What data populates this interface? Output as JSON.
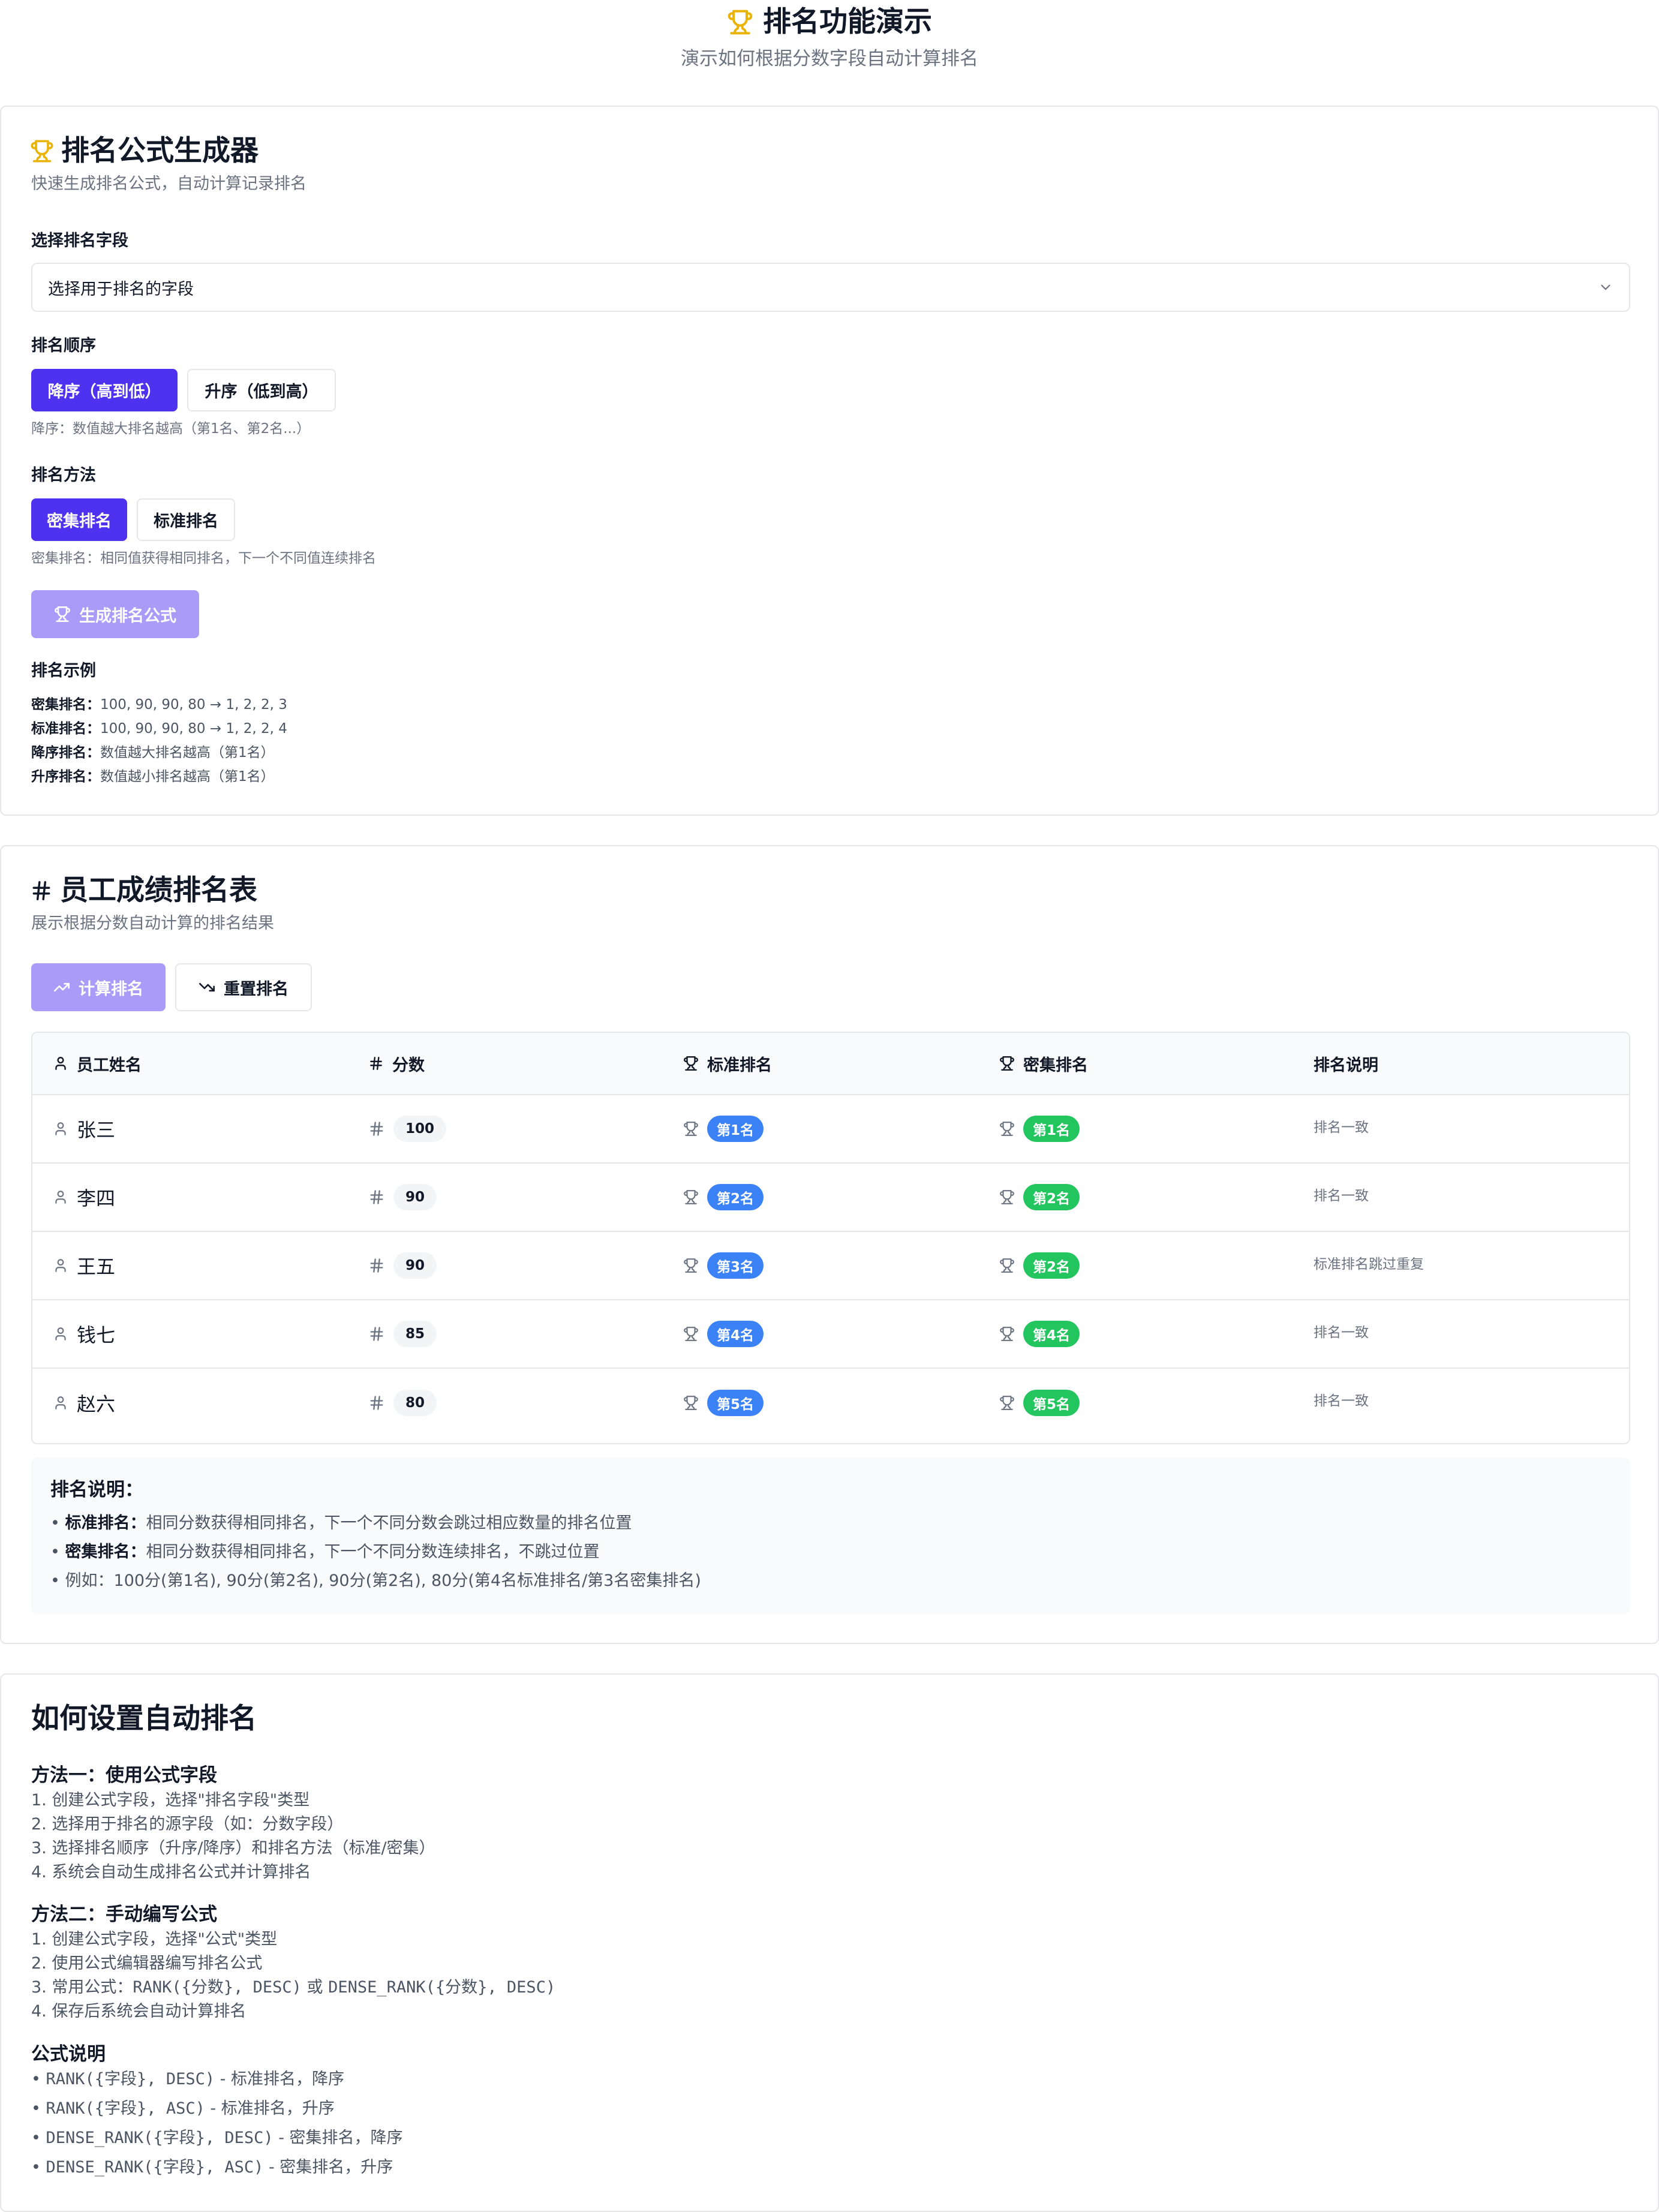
{
  "header": {
    "title": "排名功能演示",
    "subtitle": "演示如何根据分数字段自动计算排名"
  },
  "generator": {
    "title": "排名公式生成器",
    "description": "快速生成排名公式，自动计算记录排名",
    "field_label": "选择排名字段",
    "field_placeholder": "选择用于排名的字段",
    "order_label": "排名顺序",
    "order_desc_btn": "降序（高到低）",
    "order_asc_btn": "升序（低到高）",
    "order_hint": "降序：数值越大排名越高（第1名、第2名...）",
    "method_label": "排名方法",
    "method_dense_btn": "密集排名",
    "method_standard_btn": "标准排名",
    "method_hint": "密集排名：相同值获得相同排名，下一个不同值连续排名",
    "generate_btn": "生成排名公式",
    "examples_title": "排名示例",
    "examples": [
      {
        "key": "密集排名：",
        "text": "100, 90, 90, 80 → 1, 2, 2, 3"
      },
      {
        "key": "标准排名：",
        "text": "100, 90, 90, 80 → 1, 2, 2, 4"
      },
      {
        "key": "降序排名：",
        "text": "数值越大排名越高（第1名）"
      },
      {
        "key": "升序排名：",
        "text": "数值越小排名越高（第1名）"
      }
    ]
  },
  "ranking": {
    "title": "员工成绩排名表",
    "description": "展示根据分数自动计算的排名结果",
    "calc_btn": "计算排名",
    "reset_btn": "重置排名",
    "columns": [
      "员工姓名",
      "分数",
      "标准排名",
      "密集排名",
      "排名说明"
    ],
    "rows": [
      {
        "name": "张三",
        "score": "100",
        "standard": "第1名",
        "dense": "第1名",
        "note": "排名一致"
      },
      {
        "name": "李四",
        "score": "90",
        "standard": "第2名",
        "dense": "第2名",
        "note": "排名一致"
      },
      {
        "name": "王五",
        "score": "90",
        "standard": "第3名",
        "dense": "第2名",
        "note": "标准排名跳过重复"
      },
      {
        "name": "钱七",
        "score": "85",
        "standard": "第4名",
        "dense": "第4名",
        "note": "排名一致"
      },
      {
        "name": "赵六",
        "score": "80",
        "standard": "第5名",
        "dense": "第5名",
        "note": "排名一致"
      }
    ],
    "explain_title": "排名说明：",
    "explain_lines": [
      {
        "bullet": "• ",
        "key": "标准排名：",
        "text": "相同分数获得相同排名，下一个不同分数会跳过相应数量的排名位置"
      },
      {
        "bullet": "• ",
        "key": "密集排名：",
        "text": "相同分数获得相同排名，下一个不同分数连续排名，不跳过位置"
      },
      {
        "bullet": "• ",
        "key": "",
        "text": "例如：100分(第1名), 90分(第2名), 90分(第2名), 80分(第4名标准排名/第3名密集排名)"
      }
    ]
  },
  "howto": {
    "title": "如何设置自动排名",
    "method1_title": "方法一：使用公式字段",
    "method1_steps": [
      "1. 创建公式字段，选择\"排名字段\"类型",
      "2. 选择用于排名的源字段（如：分数字段）",
      "3. 选择排名顺序（升序/降序）和排名方法（标准/密集）",
      "4. 系统会自动生成排名公式并计算排名"
    ],
    "method2_title": "方法二：手动编写公式",
    "method2_steps": [
      "1. 创建公式字段，选择\"公式\"类型",
      "2. 使用公式编辑器编写排名公式"
    ],
    "method2_step3_prefix": "3. 常用公式：",
    "method2_step3_code1": "RANK({分数}, DESC)",
    "method2_step3_mid": " 或 ",
    "method2_step3_code2": "DENSE_RANK({分数}, DESC)",
    "method2_step4": "4. 保存后系统会自动计算排名",
    "formula_title": "公式说明",
    "formulas": [
      {
        "code": "RANK({字段}, DESC)",
        "desc": " - 标准排名，降序"
      },
      {
        "code": "RANK({字段}, ASC)",
        "desc": " - 标准排名，升序"
      },
      {
        "code": "DENSE_RANK({字段}, DESC)",
        "desc": " - 密集排名，降序"
      },
      {
        "code": "DENSE_RANK({字段}, ASC)",
        "desc": " - 密集排名，升序"
      }
    ]
  },
  "colors": {
    "primary": "#4f31f0",
    "primary_light": "#a99bf7",
    "trophy_yellow": "#eab308",
    "badge_blue": "#3b82f6",
    "badge_green": "#22c55e"
  }
}
